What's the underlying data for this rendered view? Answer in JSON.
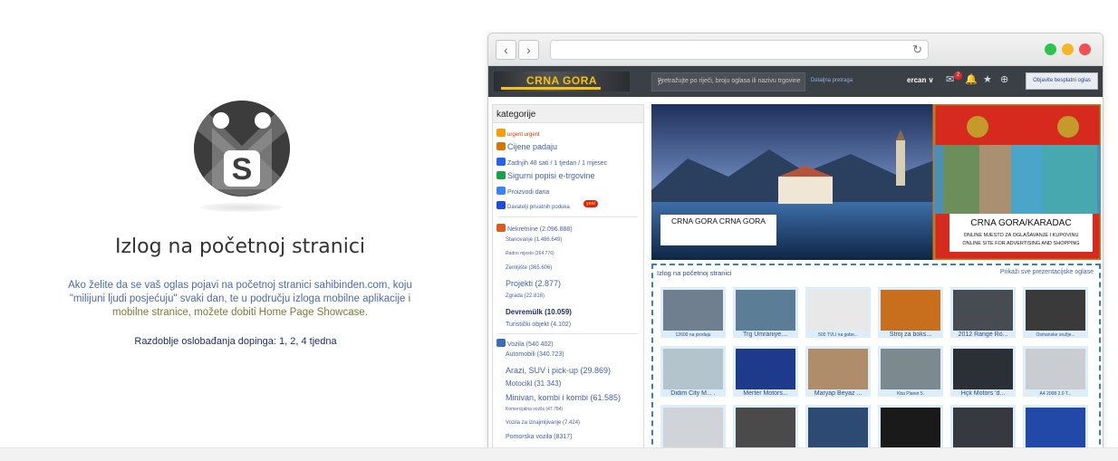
{
  "promo": {
    "title": "Izlog na početnoj stranici",
    "text1": "Ako želite da se vaš oglas pojavi na početnoj stranici sahibinden.com, koju \"milijuni ljudi posjećuju\" svaki dan, te u području izloga mobilne aplikacije i",
    "text2": "mobilne stranice, možete dobiti Home Page Showcase.",
    "dates": "Razdoblje oslobađanja dopinga: 1, 2, 4 tjedna"
  },
  "site": {
    "logo_text": "CRNA GORA",
    "search_placeholder": "Pretražujte po riječi, broju oglasa ili nazivu trgovine",
    "detail_search": "Detaljna pretraga",
    "user": "ercan ∨",
    "notification_count": "2",
    "post_button": "Objavite besplatni oglas"
  },
  "sidebar": {
    "title": "kategorije",
    "items": [
      {
        "label": "urgent urgent",
        "size": "6px",
        "color": "#c2410c",
        "icon": "#f59e0b"
      },
      {
        "label": "Cijene padaju",
        "size": "9px",
        "color": "#4563a5",
        "icon": "#d97706"
      },
      {
        "label": "Zadnjih 48 sati / 1 tjedan / 1 mjesec",
        "size": "7px",
        "color": "#4563a5",
        "icon": "#2563eb"
      },
      {
        "label": "Sigurni popisi e-trgovine",
        "size": "9px",
        "color": "#4563a5",
        "icon": "#16a34a"
      },
      {
        "label": "Proizvodi dana",
        "size": "7px",
        "color": "#4563a5",
        "icon": "#3b82f6"
      },
      {
        "label": "Davatelji privatnih poduka",
        "size": "6px",
        "color": "#4563a5",
        "icon": "#1d4ed8"
      }
    ],
    "yeni_badge": "yeni",
    "realestate": [
      {
        "label": "Nekretnine (2.096.888)",
        "size": "7px"
      },
      {
        "label": "Stanovanje (1.486.649)",
        "size": "6px"
      },
      {
        "label": "Radno mjesto (264.776)",
        "size": "5px"
      },
      {
        "label": "Zemljište (365.606)",
        "size": "6px"
      },
      {
        "label": "Projekti (2.877)",
        "size": "9px"
      },
      {
        "label": "Zgrada (22.816)",
        "size": "6px"
      },
      {
        "label": "Devremülk (10.059)",
        "size": "8px"
      },
      {
        "label": "Turistički objekt (4.102)",
        "size": "7px"
      }
    ],
    "vehicles": [
      {
        "label": "Vozila (540 402)",
        "size": "7px"
      },
      {
        "label": "Automobili (340.723)",
        "size": "7px"
      },
      {
        "label": "Arazi, SUV i pick-up (29.869)",
        "size": "9px"
      },
      {
        "label": "Motocikl (31 343)",
        "size": "8px"
      },
      {
        "label": "Minivan, kombi i kombi (61.585)",
        "size": "9px"
      },
      {
        "label": "Komercijalna vozila (47.784)",
        "size": "5px"
      },
      {
        "label": "Vozila za iznajmljivanje (7.424)",
        "size": "6px"
      },
      {
        "label": "Pomorska vozila (8317)",
        "size": "7px"
      }
    ]
  },
  "banner": {
    "caption1": "CRNA GORA CRNA GORA",
    "caption2_title": "CRNA GORA/KARADAC",
    "caption2_line1": "ONLINE MJESTO ZA OGLAŠAVANJE I KUPOVINU",
    "caption2_line2": "ONLINE SITE FOR ADVERTISING AND SHOPPING"
  },
  "showcase": {
    "title": "Izlog na početnoj stranici",
    "show_all": "Prikaži sve prezentacijske oglase",
    "tiles": [
      {
        "label": "12600 na prodaju",
        "small": true,
        "color": "#6f7f8f"
      },
      {
        "label": "Trg Ümraniye....",
        "small": false,
        "color": "#5b7d95"
      },
      {
        "label": "500 TVLI na gobe...",
        "small": true,
        "color": "#e8e8e8"
      },
      {
        "label": "Stroj za boks...",
        "small": false,
        "color": "#c86f1e"
      },
      {
        "label": "2012 Range Ro...",
        "small": false,
        "color": "#474b52"
      },
      {
        "label": "Osmanske oružje...",
        "small": true,
        "color": "#3a3a3a"
      },
      {
        "label": "Didim City M... .",
        "small": false,
        "color": "#b4c4cc"
      },
      {
        "label": "Merter Motors...",
        "small": false,
        "color": "#1e3a8a"
      },
      {
        "label": "Maryap Beyaz ...",
        "small": false,
        "color": "#b08d6a"
      },
      {
        "label": "Kba Planet 5.",
        "small": true,
        "color": "#7c8a8f"
      },
      {
        "label": "Hçk Motors 'd...",
        "small": false,
        "color": "#2b2f36"
      },
      {
        "label": "A4 2008 2.0 T...",
        "small": true,
        "color": "#c9cdd1"
      },
      {
        "label": "",
        "small": true,
        "color": "#d0d4d8"
      },
      {
        "label": "",
        "small": true,
        "color": "#4a4a4a"
      },
      {
        "label": "",
        "small": true,
        "color": "#2d4a73"
      },
      {
        "label": "",
        "small": true,
        "color": "#1a1a1a"
      },
      {
        "label": "",
        "small": true,
        "color": "#36393f"
      },
      {
        "label": "",
        "small": true,
        "color": "#2249a8"
      },
      {
        "label": "",
        "small": true,
        "color": "#5a4a4a"
      }
    ]
  },
  "colors": {
    "accent_blue": "#2f7fd3",
    "header_dark": "#3b3f46",
    "logo_yellow": "#f4c20d",
    "flag_red": "#d62a1e"
  }
}
